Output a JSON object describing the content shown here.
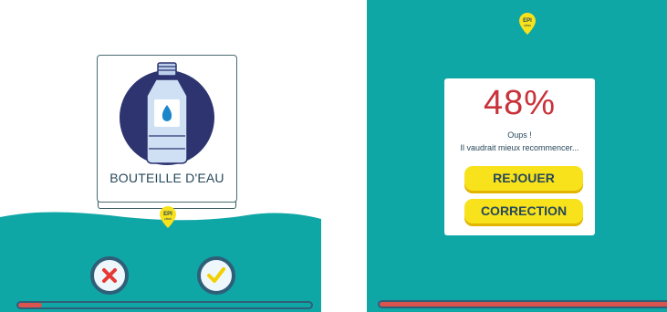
{
  "left_screen": {
    "card": {
      "label": "BOUTEILLE D'EAU",
      "icon": "water-bottle-icon"
    },
    "badge": {
      "text_top": "EPI",
      "text_bottom": "class",
      "icon": "epi-pin-icon"
    },
    "buttons": {
      "reject_icon": "x-mark-icon",
      "accept_icon": "checkmark-icon"
    },
    "progress": {
      "fraction": 0.08
    }
  },
  "right_screen": {
    "badge": {
      "text_top": "EPI",
      "text_bottom": "class",
      "icon": "epi-pin-icon"
    },
    "result": {
      "score": "48%",
      "message_line1": "Oups !",
      "message_line2": "Il vaudrait mieux recommencer..."
    },
    "buttons": {
      "replay_label": "REJOUER",
      "correction_label": "CORRECTION"
    },
    "progress": {
      "fraction": 1.0
    }
  },
  "colors": {
    "teal": "#0fa6a6",
    "dark_navy": "#27485a",
    "accent_yellow": "#f7e21b",
    "score_red": "#c8323a",
    "bottle_circle": "#2d3470"
  }
}
